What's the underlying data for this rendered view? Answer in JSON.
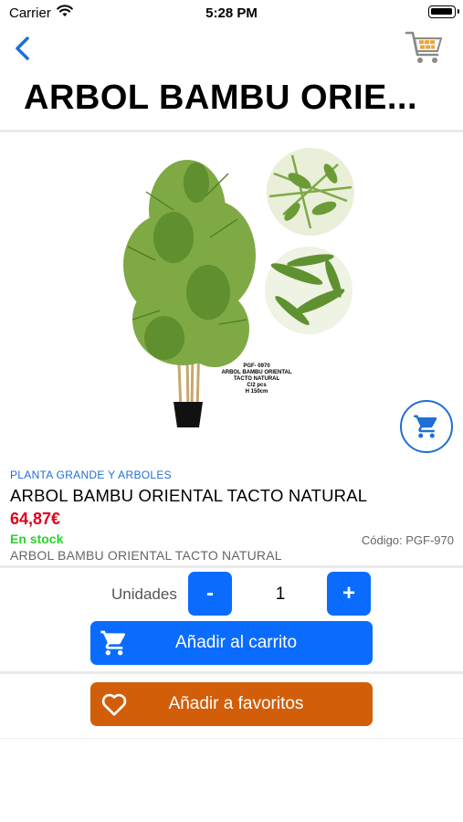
{
  "status_bar": {
    "carrier": "Carrier",
    "time": "5:28 PM"
  },
  "nav": {
    "title": "ARBOL BAMBU ORIE..."
  },
  "image": {
    "caption_lines": [
      "PGF- 0970",
      "ARBOL BAMBU ORIENTAL",
      "TACTO NATURAL",
      "C/2 pcs",
      "H 150cm"
    ]
  },
  "product": {
    "category": "PLANTA GRANDE Y ARBOLES",
    "name": "ARBOL BAMBU ORIENTAL TACTO NATURAL",
    "price": "64,87€",
    "stock": "En stock",
    "code": "Código: PGF-970",
    "description": "ARBOL BAMBU ORIENTAL TACTO NATURAL"
  },
  "quantity": {
    "label": "Unidades",
    "minus": "-",
    "value": "1",
    "plus": "+"
  },
  "actions": {
    "add_to_cart": "Añadir al carrito",
    "add_to_favorites": "Añadir a favoritos"
  },
  "colors": {
    "accent_blue": "#0a6cff",
    "price_red": "#e0001b",
    "stock_green": "#27d42a",
    "favorites_orange": "#d25e0a"
  },
  "icons": {
    "back": "chevron-left-icon",
    "cart_top": "shopping-cart-icon",
    "fab_cart": "cart-icon",
    "button_cart": "cart-icon",
    "button_heart": "heart-icon"
  }
}
